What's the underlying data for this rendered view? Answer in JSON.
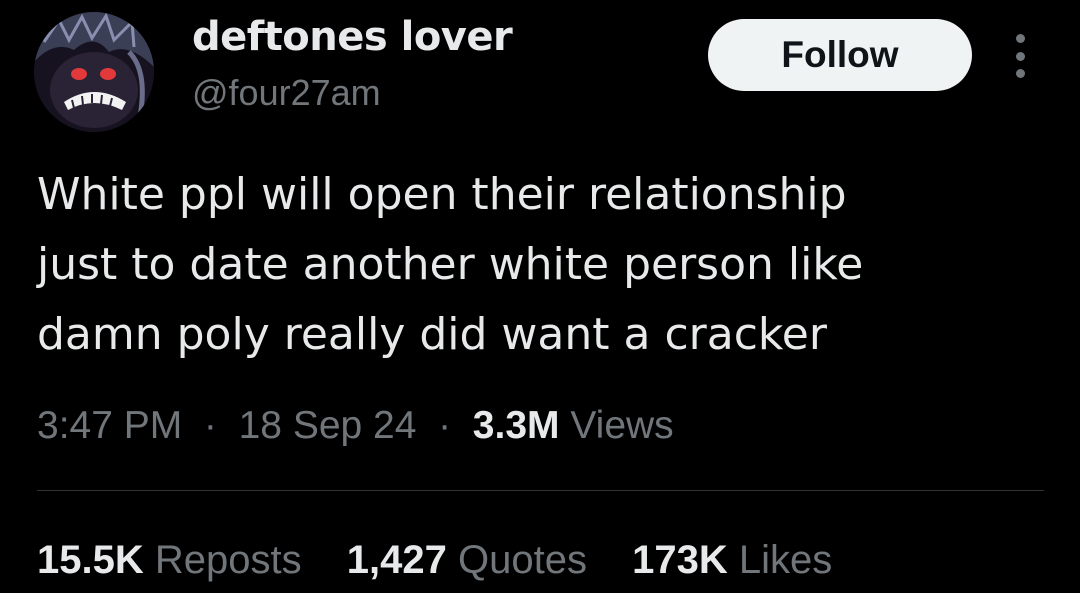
{
  "user": {
    "display_name": "deftones lover",
    "handle": "@four27am",
    "avatar_icon": "avatar-icon"
  },
  "actions": {
    "follow_label": "Follow",
    "more_icon": "more-options-icon"
  },
  "tweet": {
    "lines": [
      "White ppl will open their relationship",
      "just to date another white person like",
      "damn poly really did want a cracker"
    ],
    "time": "3:47 PM",
    "date": "18 Sep 24",
    "views_count": "3.3M",
    "views_label": "Views",
    "separator": "·"
  },
  "stats": {
    "reposts_count": "15.5K",
    "reposts_label": "Reposts",
    "quotes_count": "1,427",
    "quotes_label": "Quotes",
    "likes_count": "173K",
    "likes_label": "Likes"
  },
  "colors": {
    "background": "#000000",
    "primary_text": "#e7e9ea",
    "secondary_text": "#71767b",
    "follow_bg": "#eff3f4",
    "divider": "#2f3336"
  }
}
